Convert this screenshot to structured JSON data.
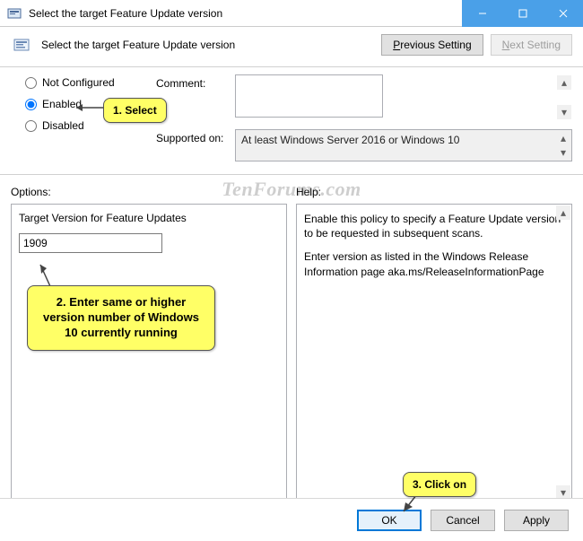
{
  "titlebar": {
    "title": "Select the target Feature Update version"
  },
  "header": {
    "policy_title": "Select the target Feature Update version",
    "prev_button": "Previous Setting",
    "next_button": "Next Setting"
  },
  "config": {
    "radios": {
      "not_configured": "Not Configured",
      "enabled": "Enabled",
      "disabled": "Disabled"
    },
    "comment_label": "Comment:",
    "comment_value": "",
    "supported_label": "Supported on:",
    "supported_value": "At least Windows Server 2016 or Windows 10"
  },
  "lower": {
    "options_label": "Options:",
    "help_label": "Help:",
    "option_field_label": "Target Version for Feature Updates",
    "option_field_value": "1909",
    "help_text_1": "Enable this policy to specify a Feature Update version to be requested in subsequent scans.",
    "help_text_2": "Enter version as listed in the Windows Release Information page aka.ms/ReleaseInformationPage"
  },
  "footer": {
    "ok": "OK",
    "cancel": "Cancel",
    "apply": "Apply"
  },
  "callouts": {
    "c1": "1. Select",
    "c2": "2. Enter same or higher version number of Windows 10 currently running",
    "c3": "3. Click on"
  },
  "watermark": "TenForums.com"
}
